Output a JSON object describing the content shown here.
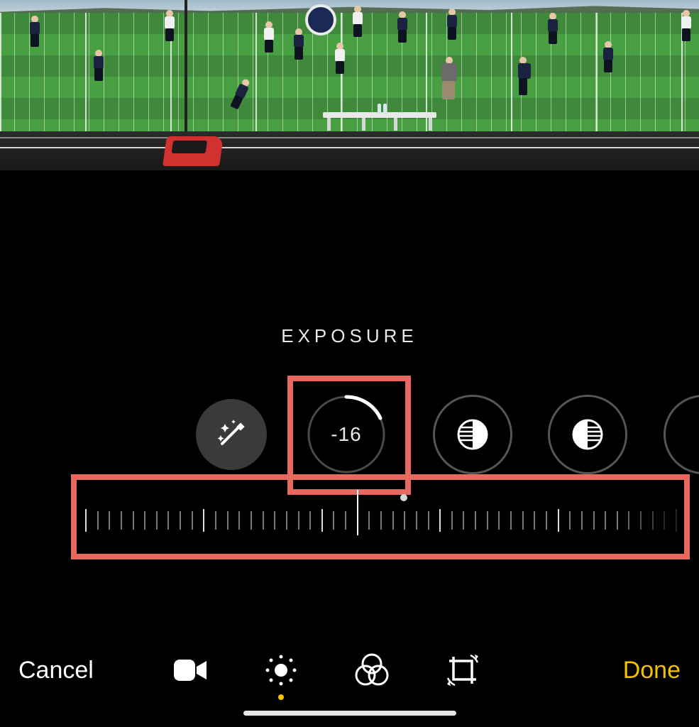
{
  "adjustment": {
    "label": "EXPOSURE",
    "value": "-16"
  },
  "circles": {
    "wand": "auto-enhance-icon",
    "exposure": "exposure-icon",
    "brilliance": "brilliance-icon",
    "highlights": "highlights-icon"
  },
  "bottombar": {
    "cancel": "Cancel",
    "done": "Done",
    "tabs": {
      "video": "video-icon",
      "adjust": "adjust-icon",
      "filters": "filters-icon",
      "crop": "crop-icon"
    },
    "active_tab": "adjust"
  },
  "slider": {
    "tick_count": 51,
    "major_every": 10,
    "center_index": 23,
    "zero_index": 27
  },
  "colors": {
    "highlight": "#e86a5e",
    "accent": "#f2c200"
  }
}
